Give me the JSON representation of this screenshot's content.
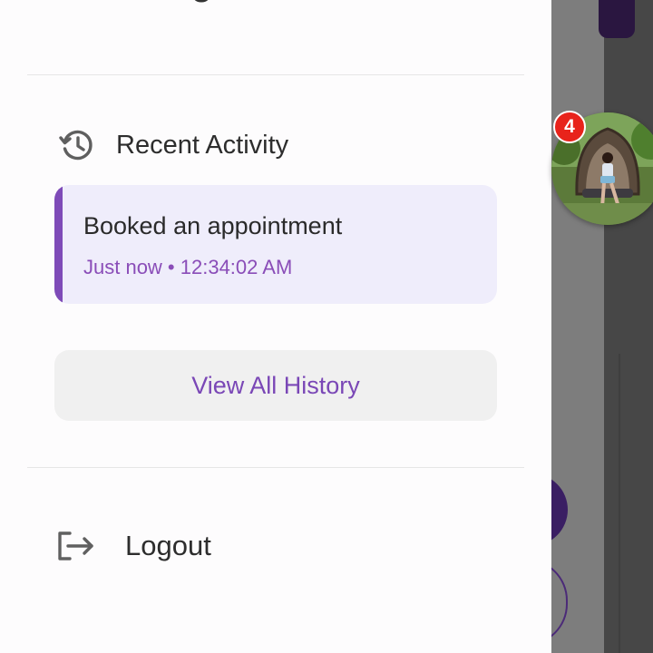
{
  "drawer": {
    "top_item_partial": {
      "icon": "settings-gear-icon"
    },
    "recent_activity": {
      "icon": "history-icon",
      "title": "Recent Activity",
      "items": [
        {
          "title": "Booked an appointment",
          "meta": "Just now • 12:34:02 AM"
        }
      ],
      "view_all_label": "View All History"
    },
    "logout": {
      "icon": "logout-icon",
      "label": "Logout"
    }
  },
  "chat_head": {
    "badge_count": "4",
    "avatar": "user-photo"
  },
  "colors": {
    "accent": "#7e4bb8",
    "card_bg": "#efedfb",
    "badge": "#e8231b",
    "scrim_bg": "#7d7d7d"
  }
}
